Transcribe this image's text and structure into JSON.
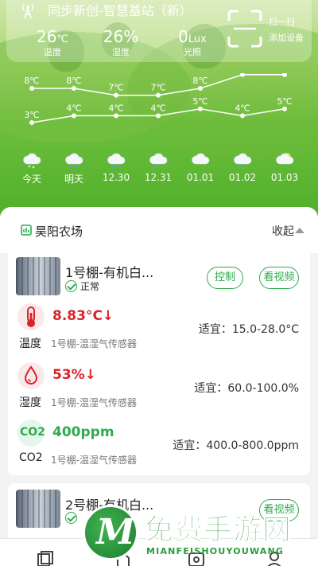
{
  "station": {
    "name": "同步新创-智慧基站（新）",
    "metrics": [
      {
        "value": "26",
        "unit": "℃",
        "label": "温度"
      },
      {
        "value": "26",
        "unit": "%",
        "label": "湿度"
      },
      {
        "value": "0",
        "unit": "Lux",
        "label": "光照"
      }
    ],
    "scan_label": "扫一扫",
    "add_device_label": "添加设备"
  },
  "forecast": {
    "days": [
      {
        "label": "今天",
        "high": "8℃",
        "low": "3℃",
        "icon": "snow-cloud-icon",
        "high_value": 8,
        "low_value": 3
      },
      {
        "label": "明天",
        "high": "8℃",
        "low": "4℃",
        "icon": "rain-cloud-icon",
        "high_value": 8,
        "low_value": 4
      },
      {
        "label": "12.30",
        "high": "7℃",
        "low": "4℃",
        "icon": "rain-cloud-icon",
        "high_value": 7,
        "low_value": 4
      },
      {
        "label": "12.31",
        "high": "7℃",
        "low": "4℃",
        "icon": "rain-cloud-icon",
        "high_value": 7,
        "low_value": 4
      },
      {
        "label": "01.01",
        "high": "8℃",
        "low": "5℃",
        "icon": "cloud-icon",
        "high_value": 8,
        "low_value": 5
      },
      {
        "label": "01.02",
        "high": "10℃",
        "low": "4℃",
        "icon": "rain-cloud-icon",
        "high_value": 10,
        "low_value": 4
      },
      {
        "label": "01.03",
        "high": "10℃",
        "low": "5℃",
        "icon": "sun-cloud-icon",
        "high_value": 10,
        "low_value": 5
      }
    ]
  },
  "farm": {
    "name": "昊阳农场",
    "collapse_label": "收起"
  },
  "greenhouses": [
    {
      "name": "1号棚-有机白...",
      "status": "正常",
      "control_label": "控制",
      "video_label": "看视频",
      "sensors": [
        {
          "value": "8.83°C",
          "trend": "↓",
          "label": "温度",
          "source": "1号棚-温湿气传感器",
          "range": "适宜：15.0-28.0°C",
          "icon": "thermometer-icon"
        },
        {
          "value": "53%",
          "trend": "↓",
          "label": "湿度",
          "source": "1号棚-温湿气传感器",
          "range": "适宜：60.0-100.0%",
          "icon": "droplet-icon"
        },
        {
          "value": "400ppm",
          "trend": "",
          "label": "CO2",
          "source": "1号棚-温湿气传感器",
          "range": "适宜：400.0-800.0ppm",
          "icon": "co2-icon",
          "icon_text": "CO2"
        }
      ]
    },
    {
      "name": "2号棚-有机白...",
      "status": "",
      "video_label": "看视频"
    }
  ],
  "watermark": {
    "title": "免费手游网",
    "subtitle": "MIANFEISHOUYOUWANG",
    "logo_letter": "M"
  },
  "colors": {
    "brand_green": "#2fab4f",
    "alert_red": "#d8232a"
  }
}
